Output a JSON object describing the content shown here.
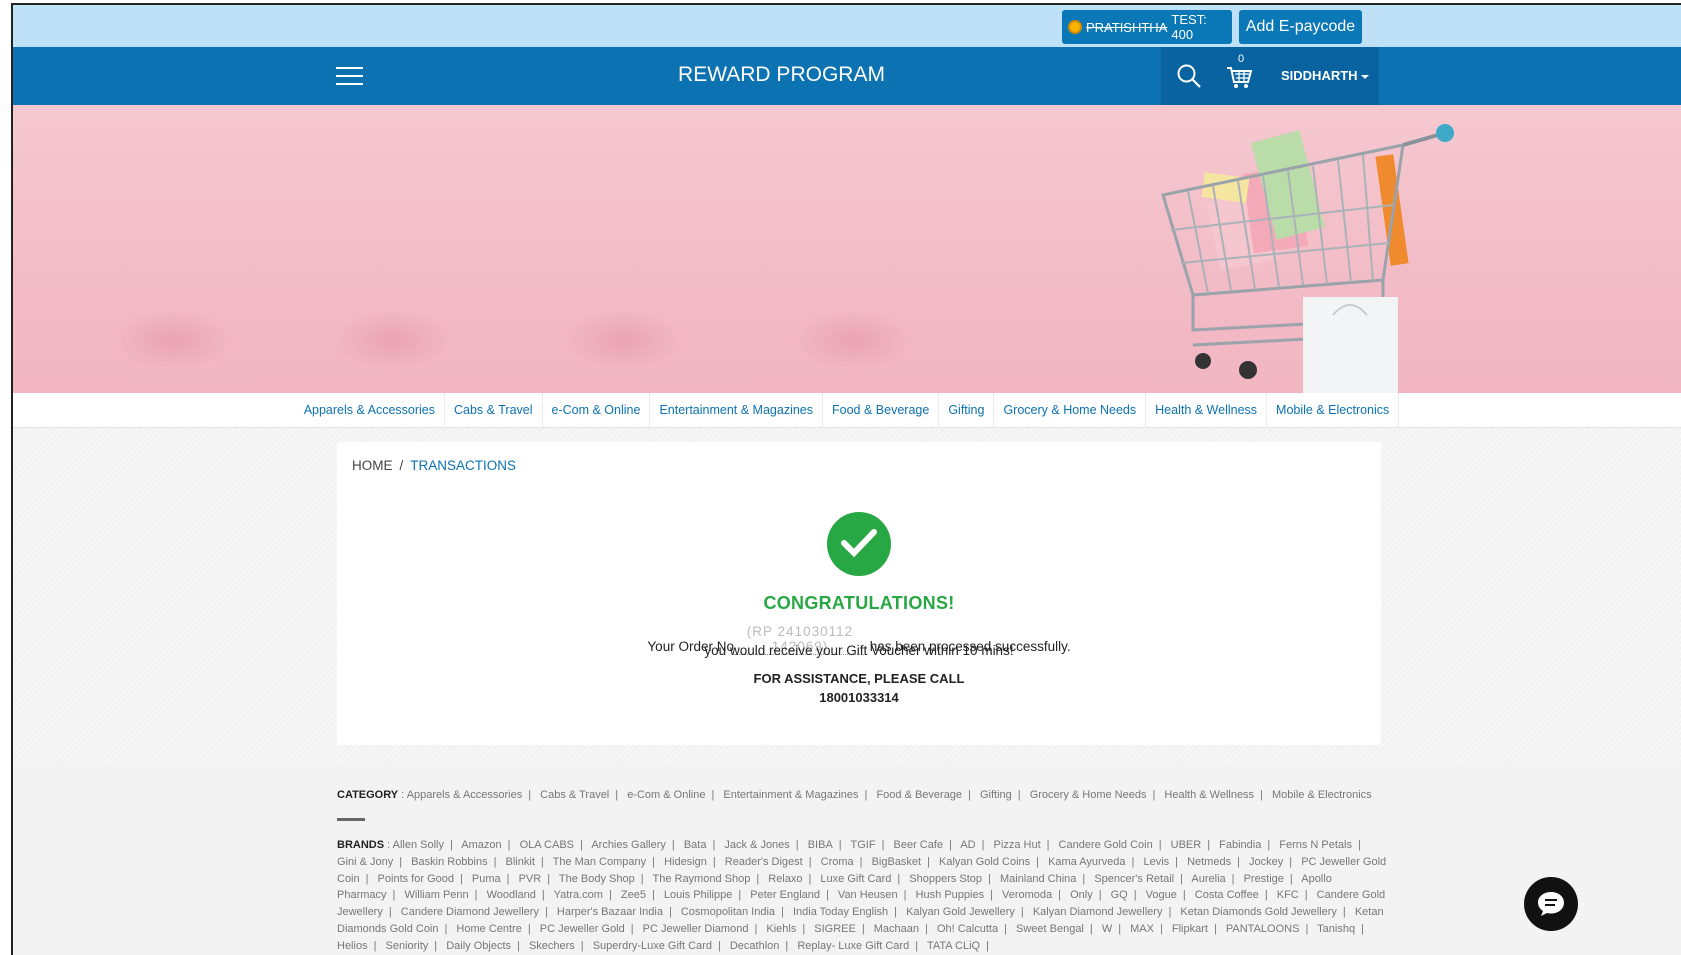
{
  "topbar": {
    "points_name": "PRATISHTHA",
    "points_suffix": " TEST: 400",
    "add_epaycode": "Add E-paycode"
  },
  "header": {
    "title": "REWARD PROGRAM",
    "cart_count": "0",
    "user": "SIDDHARTH"
  },
  "categories": [
    "Apparels & Accessories",
    "Cabs & Travel",
    "e-Com & Online",
    "Entertainment & Magazines",
    "Food & Beverage",
    "Gifting",
    "Grocery & Home Needs",
    "Health & Wellness",
    "Mobile & Electronics"
  ],
  "breadcrumb": {
    "home": "HOME",
    "current": "TRANSACTIONS"
  },
  "success": {
    "heading": "CONGRATULATIONS!",
    "line1_prefix": "Your Order No",
    "order_no": "(RP 241030112 142069)",
    "line1_suffix": " has been processed successfully.",
    "line2": "you would receive your Gift Voucher within 10 mins!",
    "assistance": "FOR ASSISTANCE, PLEASE CALL",
    "phone": "18001033314"
  },
  "footer": {
    "category_label": "CATEGORY",
    "brands_label": "BRANDS",
    "brands": [
      "Allen Solly",
      "Amazon",
      "OLA CABS",
      "Archies Gallery",
      "Bata",
      "Jack & Jones",
      "BIBA",
      "TGIF",
      "Beer Cafe",
      "AD",
      "Pizza Hut",
      "Candere Gold Coin",
      "UBER",
      "Fabindia",
      "Ferns N Petals",
      "Gini & Jony",
      "Baskin Robbins",
      "Blinkit",
      "The Man Company",
      "Hidesign",
      "Reader's Digest",
      "Croma",
      "BigBasket",
      "Kalyan Gold Coins",
      "Kama Ayurveda",
      "Levis",
      "Netmeds",
      "Jockey",
      "PC Jeweller Gold Coin",
      "Points for Good",
      "Puma",
      "PVR",
      "The Body Shop",
      "The Raymond Shop",
      "Relaxo",
      "Luxe Gift Card",
      "Shoppers Stop",
      "Mainland China",
      "Spencer's Retail",
      "Aurelia",
      "Prestige",
      "Apollo Pharmacy",
      "William Penn",
      "Woodland",
      "Yatra.com",
      "Zee5",
      "Louis Philippe",
      "Peter England",
      "Van Heusen",
      "Hush Puppies",
      "Veromoda",
      "Only",
      "GQ",
      "Vogue",
      "Costa Coffee",
      "KFC",
      "Candere Gold Jewellery",
      "Candere Diamond Jewellery",
      "Harper's Bazaar India",
      "Cosmopolitan India",
      "India Today English",
      "Kalyan Gold Jewellery",
      "Kalyan Diamond Jewellery",
      "Ketan Diamonds Gold Jewellery",
      "Ketan Diamonds Gold Coin",
      "Home Centre",
      "PC Jeweller Gold",
      "PC Jeweller Diamond",
      "Kiehls",
      "SIGREE",
      "Machaan",
      "Oh! Calcutta",
      "Sweet Bengal",
      "W",
      "MAX",
      "Flipkart",
      "PANTALOONS",
      "Tanishq",
      "Helios",
      "Seniority",
      "Daily Objects",
      "Skechers",
      "Superdry-Luxe Gift Card",
      "Decathlon",
      "Replay- Luxe Gift Card",
      "TATA CLiQ"
    ]
  },
  "colors": {
    "primary": "#0c72b1",
    "success": "#27a844",
    "topstrip": "#bfe1f7"
  }
}
